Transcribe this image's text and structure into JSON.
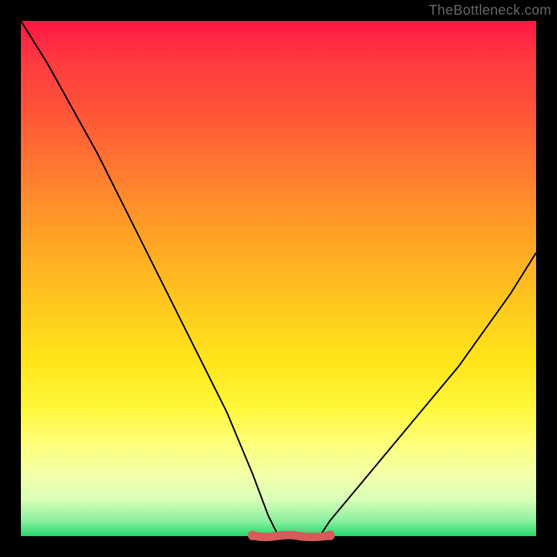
{
  "watermark": "TheBottleneck.com",
  "chart_data": {
    "type": "line",
    "title": "",
    "xlabel": "",
    "ylabel": "",
    "xlim": [
      0,
      100
    ],
    "ylim": [
      0,
      100
    ],
    "grid": false,
    "legend": false,
    "background": "red-to-green-vertical-gradient",
    "series": [
      {
        "name": "curve",
        "x": [
          0,
          5,
          10,
          15,
          20,
          25,
          30,
          35,
          40,
          45,
          48,
          50,
          53,
          55,
          58,
          60,
          65,
          70,
          75,
          80,
          85,
          90,
          95,
          100
        ],
        "values": [
          100,
          92,
          83,
          74,
          64,
          54,
          44,
          34,
          24,
          12,
          4,
          0,
          0,
          0,
          0,
          3,
          9,
          15,
          21,
          27,
          33,
          40,
          47,
          55
        ]
      }
    ],
    "bottom_band": {
      "x_start": 45,
      "x_end": 60,
      "value": 0,
      "color": "#d85a5a"
    }
  }
}
